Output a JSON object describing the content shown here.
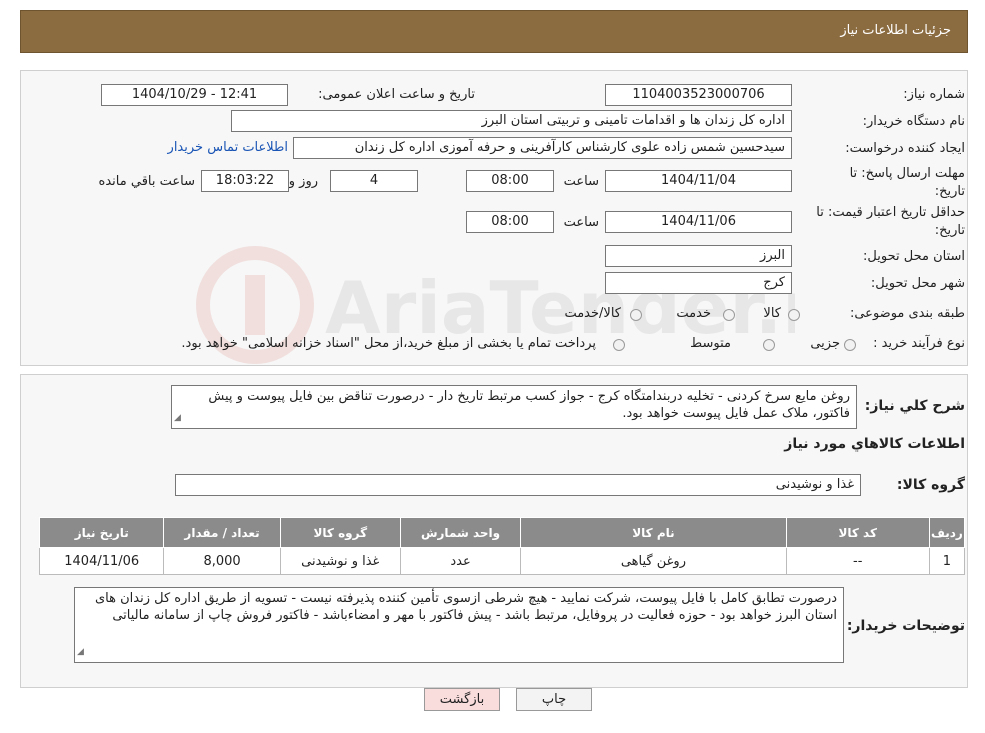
{
  "header": {
    "title": "جزئیات اطلاعات نیاز"
  },
  "form": {
    "need_number_label": "شماره نیاز:",
    "need_number": "1104003523000706",
    "announce_label": "تاریخ و ساعت اعلان عمومی:",
    "announce_value": "1404/10/29 - 12:41",
    "buyer_label": "نام دستگاه خریدار:",
    "buyer_value": "اداره کل زندان ها و اقدامات تامینی و تربیتی استان البرز",
    "creator_label": "ایجاد کننده درخواست:",
    "creator_value": "سیدحسین شمس زاده علوی کارشناس کارآفرینی و حرفه آموزی اداره کل زندان",
    "contact_link": "اطلاعات تماس خریدار",
    "deadline_label_1": "مهلت ارسال پاسخ: تا",
    "deadline_label_2": "تاریخ:",
    "deadline_date": "1404/11/04",
    "time_label": "ساعت",
    "deadline_time": "08:00",
    "days_value": "4",
    "days_label": "روز و",
    "remaining_time": "18:03:22",
    "remaining_label": "ساعت باقي مانده",
    "validity_label_1": "حداقل تاریخ اعتبار قیمت: تا",
    "validity_label_2": "تاریخ:",
    "validity_date": "1404/11/06",
    "validity_time": "08:00",
    "province_label": "استان محل تحویل:",
    "province_value": "البرز",
    "city_label": "شهر محل تحویل:",
    "city_value": "کرج",
    "category_label": "طبقه بندی موضوعی:",
    "category_options": [
      "کالا",
      "خدمت",
      "کالا/خدمت"
    ],
    "process_label": "نوع فرآیند خرید :",
    "process_options": [
      "جزیی",
      "متوسط"
    ],
    "process_note": "پرداخت تمام یا بخشی از مبلغ خرید،از محل \"اسناد خزانه اسلامی\" خواهد بود."
  },
  "description": {
    "label": "شرح کلي نياز:",
    "text": "روغن مایع سرخ کردنی - تخلیه دربندامتگاه کرج - جواز کسب مرتبط تاریخ دار - درصورت تناقض بین فایل پیوست و پیش فاکتور، ملاک عمل فایل پیوست خواهد بود."
  },
  "goods": {
    "section_title": "اطلاعات کالاهاي مورد نياز",
    "group_label": "گروه کالا:",
    "group_value": "غذا و نوشیدنی",
    "columns": [
      "رديف",
      "کد کالا",
      "نام کالا",
      "واحد شمارش",
      "گروه کالا",
      "تعداد / مقدار",
      "تاريخ نياز"
    ],
    "rows": [
      [
        "1",
        "--",
        "روغن گیاهی",
        "عدد",
        "غذا و نوشیدنی",
        "8,000",
        "1404/11/06"
      ]
    ]
  },
  "buyer_notes": {
    "label": "توضیحات خریدار:",
    "text": "درصورت تطابق کامل با فایل پیوست، شرکت نمایید - هیچ شرطی ازسوی تأمین کننده پذیرفته نیست - تسویه از طریق اداره کل زندان های استان البرز خواهد بود - حوزه فعالیت در پروفایل، مرتبط باشد - پیش فاکتور با مهر و امضاءباشد - فاکتور فروش چاپ از سامانه مالیاتی"
  },
  "buttons": {
    "print": "چاپ",
    "back": "بازگشت"
  },
  "watermark": {
    "text": "AriaTender.neT"
  },
  "colors": {
    "header": "#8b6b40",
    "table_header": "#8b8b8b",
    "link": "#1a55b5",
    "back_button": "#f9dcdc"
  }
}
